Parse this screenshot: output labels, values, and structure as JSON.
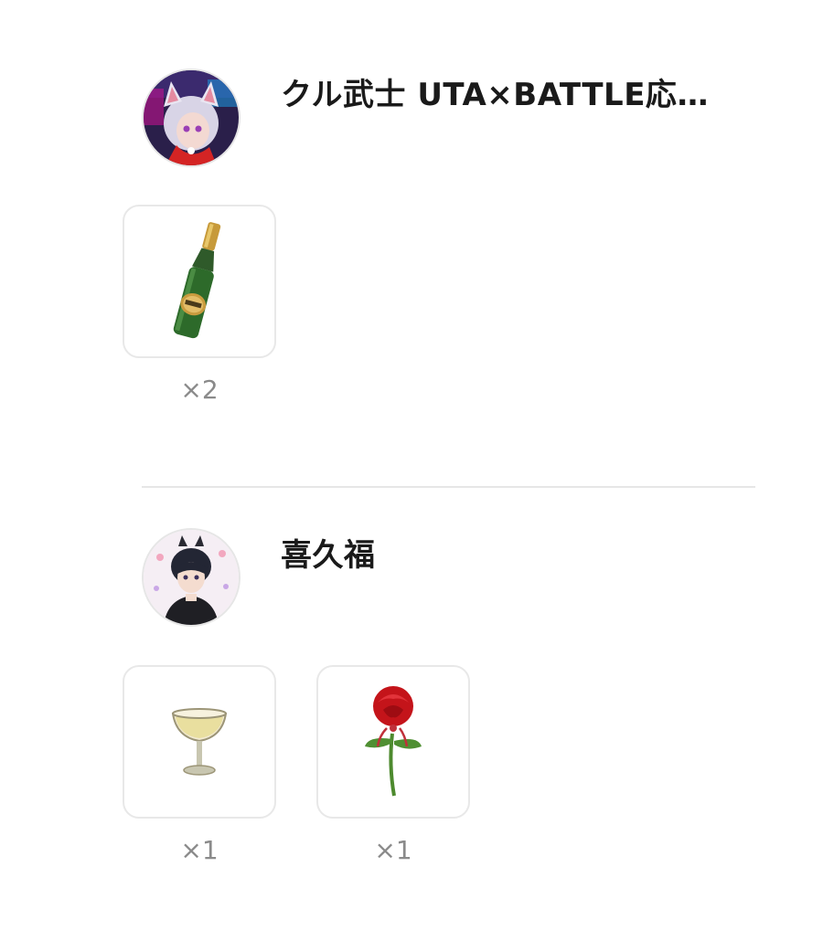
{
  "senders": [
    {
      "name": "クル武士 UTA×BATTLE応援...",
      "avatar_icon": "anime-girl-avatar",
      "gifts": [
        {
          "icon": "champagne-bottle-icon",
          "count": "×2"
        }
      ]
    },
    {
      "name": "喜久福",
      "avatar_icon": "anime-boy-avatar",
      "gifts": [
        {
          "icon": "champagne-glass-icon",
          "count": "×1"
        },
        {
          "icon": "red-rose-icon",
          "count": "×1"
        }
      ]
    }
  ],
  "colors": {
    "divider": "#e6e6e6",
    "count_text": "#8a8a8a",
    "card_border": "#e8e8e8"
  }
}
